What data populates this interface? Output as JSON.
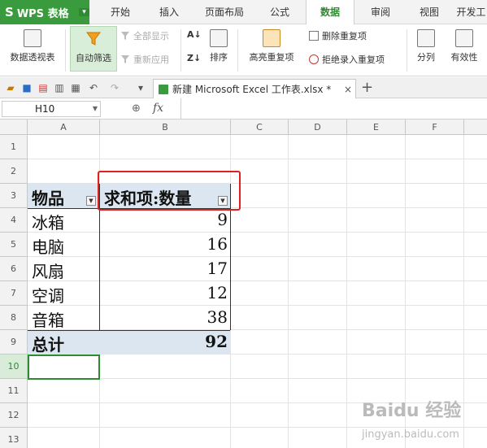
{
  "app": {
    "logo": "S",
    "title": "WPS 表格",
    "caret": "▾"
  },
  "menu_tabs": [
    {
      "label": "开始"
    },
    {
      "label": "插入"
    },
    {
      "label": "页面布局"
    },
    {
      "label": "公式"
    },
    {
      "label": "数据"
    },
    {
      "label": "审阅"
    },
    {
      "label": "视图"
    },
    {
      "label": "开发工"
    }
  ],
  "active_tab": "数据",
  "ribbon": {
    "pivot_table": "数据透视表",
    "auto_filter": "自动筛选",
    "show_all": "全部显示",
    "reapply": "重新应用",
    "sort_asc": "A↓",
    "sort_desc": "Z↓",
    "sort": "排序",
    "highlight_dup": "高亮重复项",
    "remove_dup": "删除重复项",
    "reject_dup": "拒绝录入重复项",
    "split": "分列",
    "validity": "有效性"
  },
  "document_tab": {
    "name": "新建 Microsoft Excel 工作表.xlsx *",
    "close": "×",
    "new": "+"
  },
  "formula_bar": {
    "cell_ref": "H10",
    "fx": "fx",
    "value": ""
  },
  "columns": [
    "A",
    "B",
    "C",
    "D",
    "E",
    "F"
  ],
  "rows": [
    "1",
    "2",
    "3",
    "4",
    "5",
    "6",
    "7",
    "8",
    "9",
    "10",
    "11",
    "12",
    "13"
  ],
  "selected_row": "10",
  "pivot": {
    "header_item": "物品",
    "header_value": "求和项:数量",
    "items": [
      {
        "name": "冰箱",
        "value": "9"
      },
      {
        "name": "电脑",
        "value": "16"
      },
      {
        "name": "风扇",
        "value": "17"
      },
      {
        "name": "空调",
        "value": "12"
      },
      {
        "name": "音箱",
        "value": "38"
      }
    ],
    "total_label": "总计",
    "total_value": "92"
  },
  "watermark": {
    "text": "Baidu 经验",
    "sub": "jingyan.baidu.com"
  },
  "colors": {
    "brand": "#3a9b3e",
    "pivot_header": "#dce6f1",
    "highlight": "#e0201c"
  }
}
